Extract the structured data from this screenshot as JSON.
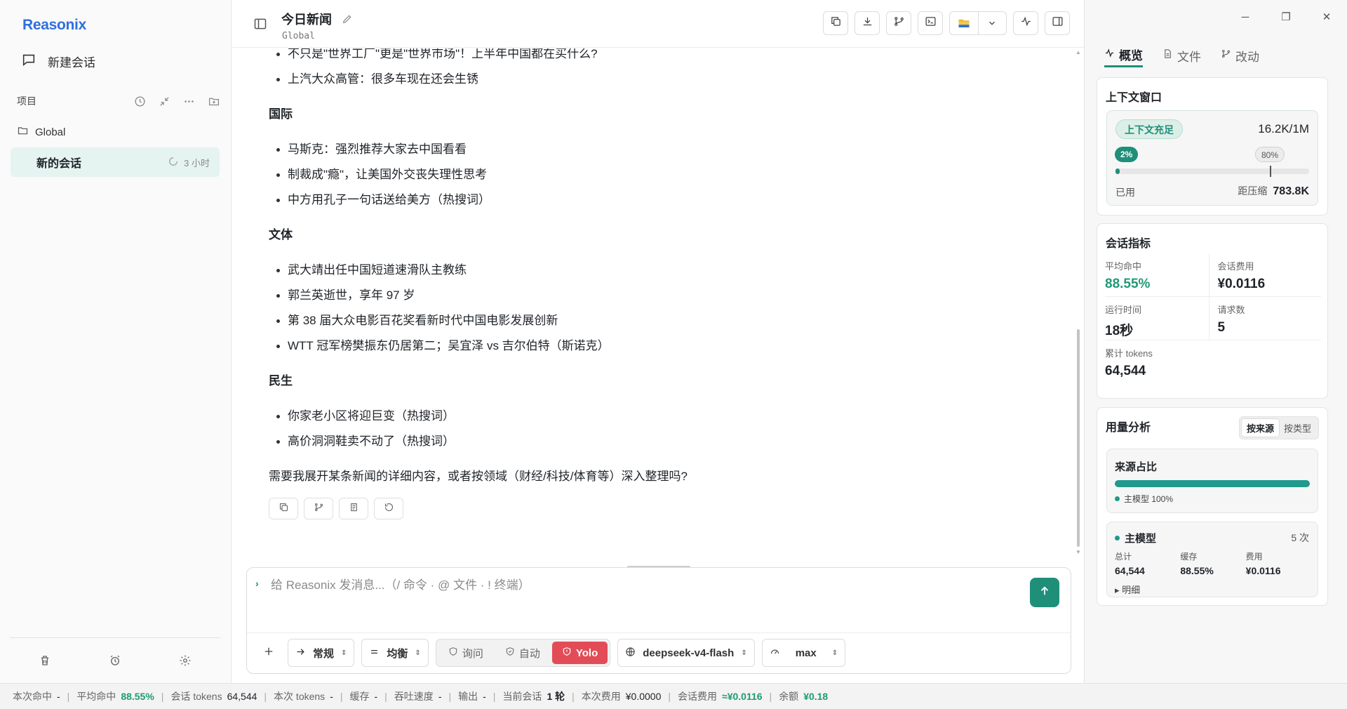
{
  "app": {
    "brand": "Reasonix"
  },
  "sidebar": {
    "new_chat": "新建会话",
    "projects_label": "项目",
    "folder": "Global",
    "session": {
      "name": "新的会话",
      "time": "3 小时"
    }
  },
  "header": {
    "title": "今日新闻",
    "subtitle": "Global"
  },
  "article": {
    "top_items": [
      "不只是\"世界工厂\"更是\"世界市场\"！上半年中国都在买什么?",
      "上汽大众高管：很多车现在还会生锈"
    ],
    "sections": [
      {
        "heading": "国际",
        "items": [
          "马斯克：强烈推荐大家去中国看看",
          "制裁成\"瘾\"，让美国外交丧失理性思考",
          "中方用孔子一句话送给美方（热搜词）"
        ]
      },
      {
        "heading": "文体",
        "items": [
          "武大靖出任中国短道速滑队主教练",
          "郭兰英逝世，享年 97 岁",
          "第 38 届大众电影百花奖看新时代中国电影发展创新",
          "WTT 冠军榜樊振东仍居第二；吴宜泽 vs 吉尔伯特（斯诺克）"
        ]
      },
      {
        "heading": "民生",
        "items": [
          "你家老小区将迎巨变（热搜词）",
          "高价洞洞鞋卖不动了（热搜词）"
        ]
      }
    ],
    "closing": "需要我展开某条新闻的详细内容，或者按领域（财经/科技/体育等）深入整理吗?"
  },
  "composer": {
    "prompt_char": "›",
    "placeholder": "给 Reasonix 发消息...（/ 命令 · @ 文件 · ! 终端）",
    "mode_select": "常规",
    "balance_select": "均衡",
    "modes": [
      "询问",
      "自动",
      "Yolo"
    ],
    "active_mode": "Yolo",
    "model": "deepseek-v4-flash",
    "effort": "max"
  },
  "right_panel": {
    "tabs": [
      "概览",
      "文件",
      "改动"
    ],
    "active_tab": "概览",
    "context": {
      "title": "上下文窗口",
      "status": "上下文充足",
      "value": "16.2K/1M",
      "used_pct_label": "2%",
      "used_fraction": 0.02,
      "threshold_label": "80%",
      "threshold_fraction": 0.8,
      "used_label": "已用",
      "remain_label": "距压缩",
      "remain_value": "783.8K"
    },
    "metrics": {
      "title": "会话指标",
      "avg_hit_label": "平均命中",
      "avg_hit": "88.55%",
      "cost_label": "会话费用",
      "cost": "¥0.0116",
      "runtime_label": "运行时间",
      "runtime": "18秒",
      "requests_label": "请求数",
      "requests": "5",
      "tokens_label": "累计 tokens",
      "tokens": "64,544"
    },
    "usage": {
      "title": "用量分析",
      "toggle": [
        "按来源",
        "按类型"
      ],
      "source_title": "来源占比",
      "source_fraction": 1.0,
      "source_legend": "主模型 100%",
      "main_model": {
        "name": "主模型",
        "count": "5 次",
        "total_label": "总计",
        "total": "64,544",
        "cache_label": "缓存",
        "cache": "88.55%",
        "cost_label": "费用",
        "cost": "¥0.0116",
        "detail": "明细"
      }
    }
  },
  "status_bar": {
    "items": [
      {
        "label": "本次命中",
        "value": "-"
      },
      {
        "label": "平均命中",
        "value": "88.55%",
        "style": "green"
      },
      {
        "label": "会话 tokens",
        "value": "64,544"
      },
      {
        "label": "本次 tokens",
        "value": "-"
      },
      {
        "label": "缓存",
        "value": "-"
      },
      {
        "label": "吞吐速度",
        "value": "-"
      },
      {
        "label": "输出",
        "value": "-"
      },
      {
        "label": "当前会话",
        "value": "1 轮",
        "style": "bold"
      },
      {
        "label": "本次费用",
        "value": "¥0.0000"
      },
      {
        "label": "会话费用",
        "value": "≈¥0.0116",
        "style": "green"
      },
      {
        "label": "余额",
        "value": "¥0.18",
        "style": "green"
      }
    ]
  },
  "colors": {
    "accent": "#1f8f7a",
    "yolo": "#e24c57",
    "brand": "#2f6fe0"
  }
}
